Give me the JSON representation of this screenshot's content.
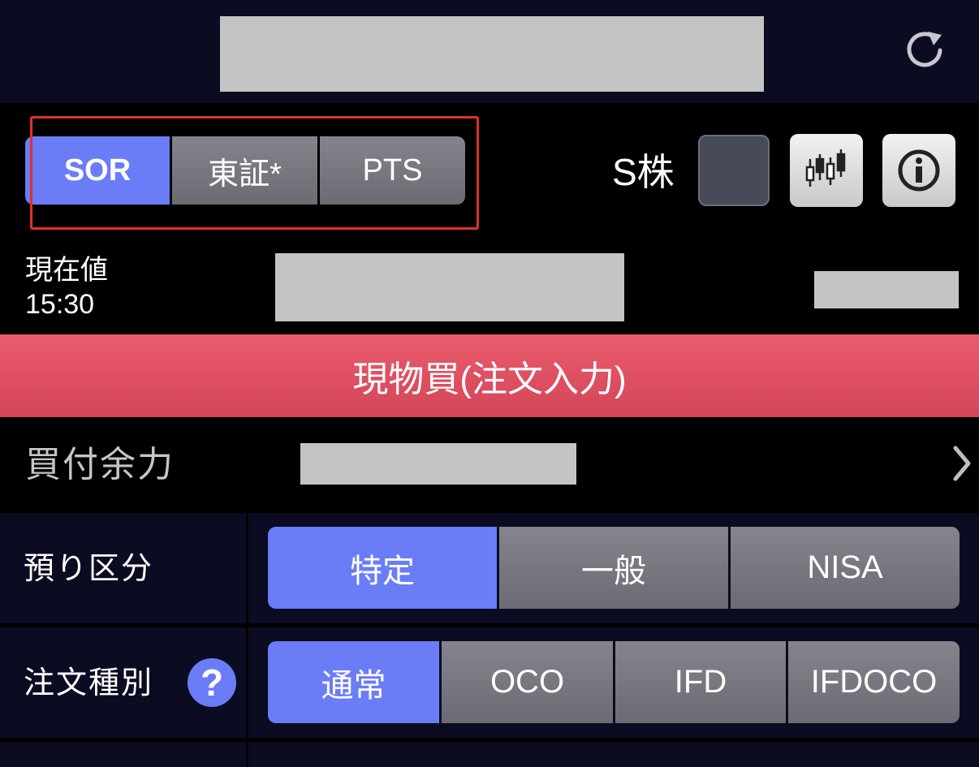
{
  "header": {
    "refresh_icon": "refresh-icon"
  },
  "market": {
    "options": [
      "SOR",
      "東証*",
      "PTS"
    ],
    "selected": "SOR"
  },
  "s_kabu": {
    "label": "S株",
    "checked": false
  },
  "icons": {
    "chart": "candlestick-chart-icon",
    "info": "info-icon",
    "chevron": "chevron-right-icon",
    "help": "help-icon"
  },
  "price": {
    "label": "現在値",
    "time": "15:30"
  },
  "order_banner": {
    "label": "現物買(注文入力)"
  },
  "buying_power": {
    "label": "買付余力"
  },
  "account_type": {
    "label": "預り区分",
    "options": [
      "特定",
      "一般",
      "NISA"
    ],
    "selected": "特定"
  },
  "order_type": {
    "label": "注文種別",
    "help_glyph": "?",
    "options": [
      "通常",
      "OCO",
      "IFD",
      "IFDOCO"
    ],
    "selected": "通常"
  },
  "colors": {
    "accent": "#6b7cf7",
    "buy_banner": "#e05266",
    "header_bg": "#0b0c22",
    "highlight": "#e0302b"
  }
}
